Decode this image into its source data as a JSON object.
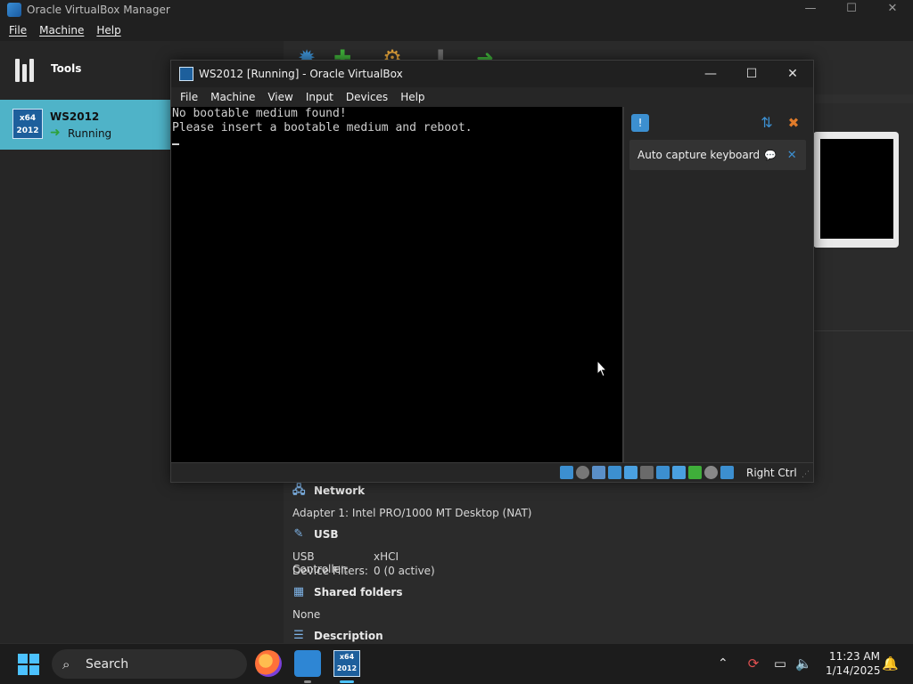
{
  "manager": {
    "title": "Oracle VirtualBox Manager",
    "controls": {
      "minimize": "—",
      "maximize": "☐",
      "close": "✕"
    },
    "menu": [
      "File",
      "Machine",
      "Help"
    ],
    "sidebar": {
      "tools_label": "Tools",
      "vm": {
        "name": "WS2012",
        "state": "Running",
        "icon_text_top": "x64",
        "icon_text_bottom": "2012"
      }
    },
    "details": {
      "network": {
        "title": "Network",
        "adapter": "Adapter 1:   Intel PRO/1000 MT Desktop (NAT)"
      },
      "usb": {
        "title": "USB",
        "controller_key": "USB Controller:",
        "controller_val": "xHCI",
        "filters_key": "Device Filters:",
        "filters_val": "0 (0 active)"
      },
      "shared": {
        "title": "Shared folders",
        "value": "None"
      },
      "description": {
        "title": "Description"
      }
    }
  },
  "vm_window": {
    "title": "WS2012 [Running] - Oracle VirtualBox",
    "controls": {
      "minimize": "—",
      "maximize": "☐",
      "close": "✕"
    },
    "menu": [
      "File",
      "Machine",
      "View",
      "Input",
      "Devices",
      "Help"
    ],
    "screen_lines": [
      "No bootable medium found!",
      "Please insert a bootable medium and reboot."
    ],
    "notification": {
      "text": "Auto capture keyboard ...",
      "help_glyph": "💬",
      "close_glyph": "✕"
    },
    "status": {
      "host_key": "Right Ctrl"
    }
  },
  "taskbar": {
    "search_label": "Search",
    "time": "11:23 AM",
    "date": "1/14/2025"
  },
  "colors": {
    "accent": "#4fb3c8",
    "windows_blue": "#4cc2ff",
    "vbox_blue": "#3c8fd0"
  }
}
